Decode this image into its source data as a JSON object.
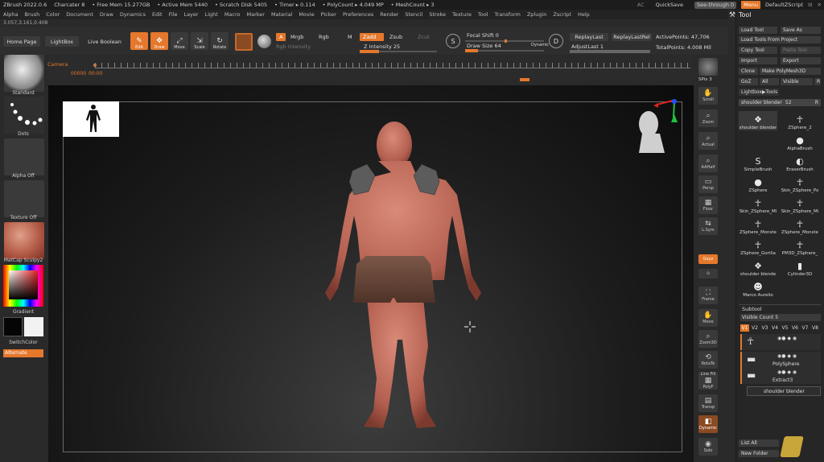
{
  "titlebar": {
    "app": "ZBrush 2022.0.6",
    "doc": "Charcater 8",
    "free_mem": "• Free Mem 15.277GB",
    "active_mem": "• Active Mem 5440",
    "scratch": "• Scratch Disk 5405",
    "timer": "• Timer ▸ 0.114",
    "polycount": "• PolyCount ▸ 4.049 MP",
    "meshcount": "• MeshCount ▸ 3",
    "ac": "AC",
    "quicksave": "QuickSave",
    "seethrough": "See-through  0",
    "menu": "Menu",
    "script": "DefaultZScript"
  },
  "menubar": [
    "Alpha",
    "Brush",
    "Color",
    "Document",
    "Draw",
    "Dynamics",
    "Edit",
    "File",
    "Layer",
    "Light",
    "Macro",
    "Marker",
    "Material",
    "Movie",
    "Picker",
    "Preferences",
    "Render",
    "Stencil",
    "Stroke",
    "Texture",
    "Tool",
    "Transform",
    "Zplugin",
    "Zscript",
    "Help"
  ],
  "coords": "3.057,3.161,0.408",
  "toolbar": {
    "home": "Home Page",
    "lightbox": "LightBox",
    "live_boolean": "Live Boolean",
    "edit": "Edit",
    "draw": "Draw",
    "move": "Move",
    "scale": "Scale",
    "rotate": "Rotate",
    "a": "A",
    "mrgb": "Mrgb",
    "rgb": "Rgb",
    "m": "M",
    "zadd": "Zadd",
    "zsub": "Zsub",
    "zcut": "Zcut",
    "rgb_intensity": "Rgb Intensity",
    "z_intensity": "Z Intensity 25",
    "focal_shift": "Focal Shift 0",
    "draw_size": "Draw Size 64",
    "dynamic": "Dynamic",
    "replay_last": "ReplayLast",
    "replay_last_rel": "ReplayLastRel",
    "adjust_last": "AdjustLast 1",
    "active_points": "ActivePoints: 47,706",
    "total_points": "TotalPoints: 4.008 Mil",
    "z_intensity_value": 0.25,
    "draw_size_value": 0.16,
    "focal_shift_value": 0.5
  },
  "timeline": {
    "label": "Camera",
    "time": "00000",
    "time2": "00:00"
  },
  "leftshelf": {
    "standard": "Standard",
    "dots": "Dots",
    "alpha": "Alpha Off",
    "texture": "Texture Off",
    "matcap": "MatCap Sculpy2",
    "gradient": "Gradient",
    "switch": "SwitchColor",
    "alternate": "Alternate"
  },
  "rightshelf": {
    "spix": "SPix 3",
    "scroll": "Scroll",
    "zoom": "Zoom",
    "actual": "Actual",
    "aahalf": "AAHalf",
    "persp": "Persp",
    "floor": "Floor",
    "lsym": "L.Sym",
    "gxyz": "Gxyz",
    "frame": "Frame",
    "move": "Move",
    "zoom3d": "Zoom3D",
    "rotate": "RotaTe",
    "linefill": "Line Fill",
    "polyf": "PolyF",
    "transp": "Transp",
    "dynamic": "Dynamic",
    "solo": "Solo"
  },
  "toolpanel": {
    "title": "Tool",
    "load_tool": "Load Tool",
    "save_as": "Save As",
    "load_tools_project": "Load Tools From Project",
    "copy_tool": "Copy Tool",
    "paste_tool": "Paste Tool",
    "import": "Import",
    "export": "Export",
    "clone": "Clone",
    "make_polymesh": "Make PolyMesh3D",
    "goz": "GoZ",
    "all": "All",
    "visible": "Visible",
    "r": "R",
    "lightbox_tools": "Lightbox▶Tools",
    "current_tool": "shoulder blender",
    "current_tool_value": "52",
    "tools": [
      {
        "label": "shoulder blender",
        "glyph": "❖"
      },
      {
        "label": "ZSphere_2",
        "glyph": "☥"
      },
      {
        "label": "",
        "glyph": ""
      },
      {
        "label": "AlphaBrush",
        "glyph": "●"
      },
      {
        "label": "SimpleBrush",
        "glyph": "S"
      },
      {
        "label": "EraserBrush",
        "glyph": "◐"
      },
      {
        "label": "ZSphere",
        "glyph": "●"
      },
      {
        "label": "Skin_ZSphere_Po",
        "glyph": "☥"
      },
      {
        "label": "Skin_ZSphere_Mi",
        "glyph": "☥"
      },
      {
        "label": "Skin_ZSphere_Mi",
        "glyph": "☥"
      },
      {
        "label": "ZSphere_Monste",
        "glyph": "☥"
      },
      {
        "label": "ZSphere_Monste",
        "glyph": "☥"
      },
      {
        "label": "ZSphere_Gorilla",
        "glyph": "☥"
      },
      {
        "label": "PM3D_ZSphere_",
        "glyph": "☥"
      },
      {
        "label": "shoulder blende",
        "glyph": "❖"
      },
      {
        "label": "Cylinder3D",
        "glyph": "▮"
      },
      {
        "label": "Marco Aurelio",
        "glyph": "☻"
      }
    ],
    "subtool_title": "Subtool",
    "visible_count": "Visible Count 5",
    "versions": [
      "V1",
      "V2",
      "V3",
      "V4",
      "V5",
      "V6",
      "V7",
      "V8"
    ],
    "subtools": [
      {
        "name": ""
      },
      {
        "name": "PolySphere"
      },
      {
        "name": "Extract3"
      },
      {
        "name": "shoulder blender"
      }
    ],
    "list_all": "List All",
    "new_folder": "New Folder"
  }
}
